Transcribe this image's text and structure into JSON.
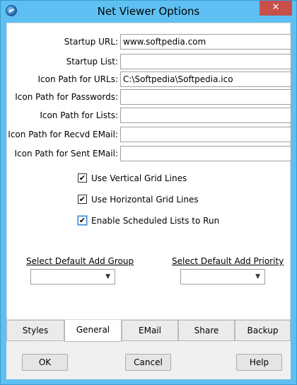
{
  "window": {
    "title": "Net Viewer Options",
    "close_glyph": "✕",
    "app_icon": "net-viewer-app-icon"
  },
  "fields": [
    {
      "label": "Startup URL:",
      "value": "www.softpedia.com"
    },
    {
      "label": "Startup List:",
      "value": ""
    },
    {
      "label": "Icon Path for URLs:",
      "value": "C:\\Softpedia\\Softpedia.ico"
    },
    {
      "label": "Icon Path for Passwords:",
      "value": ""
    },
    {
      "label": "Icon Path for Lists:",
      "value": ""
    },
    {
      "label": "Icon Path for Recvd EMail:",
      "value": ""
    },
    {
      "label": "Icon Path for Sent EMail:",
      "value": ""
    }
  ],
  "checkboxes": [
    {
      "label": "Use Vertical Grid Lines",
      "checked": true
    },
    {
      "label": "Use Horizontal Grid Lines",
      "checked": true
    },
    {
      "label": "Enable Scheduled Lists to Run",
      "checked": true
    }
  ],
  "check_glyph": "✔",
  "selects": {
    "group": {
      "label": "Select Default Add Group",
      "value": ""
    },
    "priority": {
      "label": "Select Default Add Priority",
      "value": ""
    }
  },
  "arrow_glyph": "▼",
  "tabs": [
    {
      "label": "Styles",
      "active": false
    },
    {
      "label": "General",
      "active": true
    },
    {
      "label": "EMail",
      "active": false
    },
    {
      "label": "Share",
      "active": false
    },
    {
      "label": "Backup",
      "active": false
    }
  ],
  "buttons": {
    "ok": "OK",
    "cancel": "Cancel",
    "help": "Help"
  },
  "colors": {
    "titlebar": "#5ec0f2",
    "close_button": "#c7504b"
  }
}
